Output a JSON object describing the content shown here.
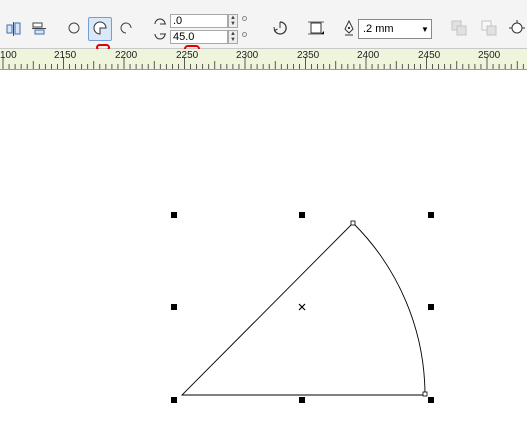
{
  "toolbar": {
    "shape_buttons": [
      {
        "name": "ellipse",
        "selected": false
      },
      {
        "name": "pie",
        "selected": true
      },
      {
        "name": "arc",
        "selected": false
      }
    ],
    "start_angle": ".0",
    "end_angle": "45.0",
    "outline_width": ".2 mm"
  },
  "ruler": {
    "labels": [
      "100",
      "2150",
      "2200",
      "2250",
      "2300",
      "2350",
      "2400",
      "2450",
      "2500"
    ]
  },
  "colors": {
    "toolbar_bg": "#f4f4f4",
    "ruler_bg": "#eff5dc",
    "annotation": "#e00000",
    "selected_button": "#dbe8f8"
  },
  "icons": [
    "align-icon",
    "wrap-icon",
    "ellipse-icon",
    "pie-icon",
    "arc-icon",
    "start-angle-icon",
    "end-angle-icon",
    "clockwise-direction-icon",
    "text-wrap-icon",
    "pen-nib-icon",
    "weld-icon",
    "trim-icon",
    "intersect-icon",
    "center-marker-icon",
    "selection-handle-icon"
  ]
}
